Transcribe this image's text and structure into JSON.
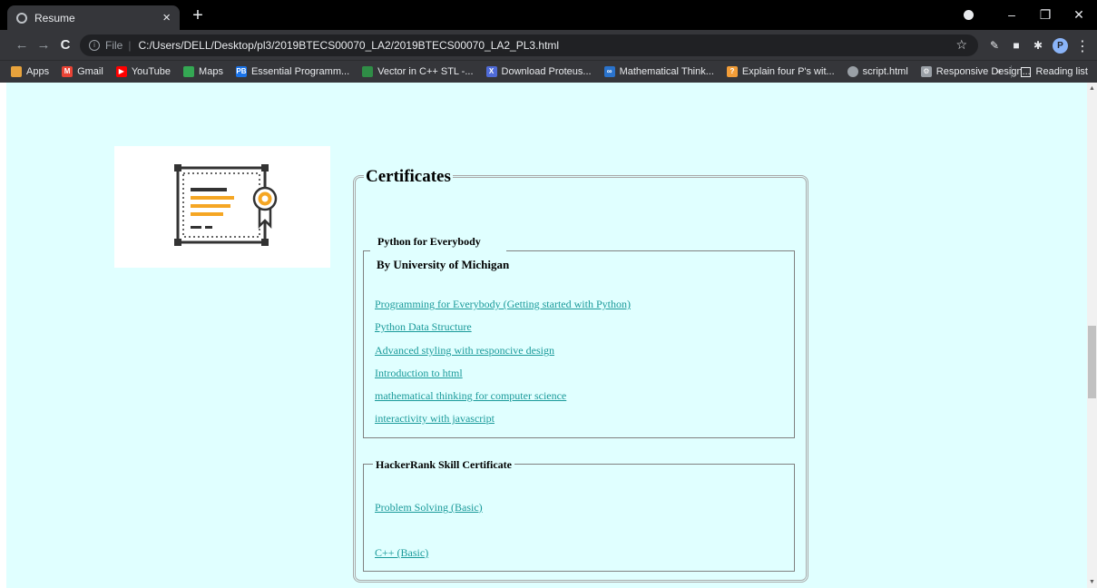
{
  "browser": {
    "tab_title": "Resume",
    "tab_close": "×",
    "new_tab": "+",
    "address_file_label": "File",
    "address_separator": "|",
    "address_url": "C:/Users/DELL/Desktop/pl3/2019BTECS00070_LA2/2019BTECS00070_LA2_PL3.html",
    "avatar_letter": "P",
    "window_controls": {
      "minimize": "–",
      "maximize": "❐",
      "close": "✕"
    },
    "nav": {
      "back": "←",
      "forward": "→",
      "reload": "C"
    }
  },
  "bookmarks": {
    "items": [
      {
        "label": "Apps",
        "icon": "apps-grid-icon",
        "color": "#e8a33c"
      },
      {
        "label": "Gmail",
        "icon": "gmail-icon",
        "color": "#ea4335"
      },
      {
        "label": "YouTube",
        "icon": "youtube-icon",
        "color": "#ff0000"
      },
      {
        "label": "Maps",
        "icon": "maps-icon",
        "color": "#34a853"
      },
      {
        "label": "Essential Programm...",
        "icon": "pb-icon",
        "color": "#1a73e8"
      },
      {
        "label": "Vector in C++ STL -...",
        "icon": "gfg-icon",
        "color": "#2f8d46"
      },
      {
        "label": "Download Proteus...",
        "icon": "proteus-icon",
        "color": "#4f6bd8"
      },
      {
        "label": "Mathematical Think...",
        "icon": "coursera-icon",
        "color": "#2a73cc"
      },
      {
        "label": "Explain four P's wit...",
        "icon": "question-icon",
        "color": "#f29d38"
      },
      {
        "label": "script.html",
        "icon": "globe-icon",
        "color": "#9aa0a6"
      },
      {
        "label": "Responsive Design...",
        "icon": "gear-icon",
        "color": "#9aa0a6"
      }
    ],
    "overflow": "»",
    "reading_list": "Reading list"
  },
  "page": {
    "section_title": "Certificates",
    "group1": {
      "legend": "Python for Everybody",
      "subtitle": "By University of Michigan",
      "links": [
        "Programming for Everybody (Getting started with Python)",
        "Python Data Structure",
        "Advanced styling with responcive design",
        "Introduction to html",
        "mathematical thinking for computer science",
        "interactivity with javascript"
      ]
    },
    "group2": {
      "legend": "HackerRank Skill Certificate",
      "links": [
        "Problem Solving (Basic)",
        "C++ (Basic)"
      ]
    },
    "colors": {
      "background": "#e0ffff",
      "link": "#1a9a9a",
      "certificate_accent": "#f5a623"
    }
  }
}
